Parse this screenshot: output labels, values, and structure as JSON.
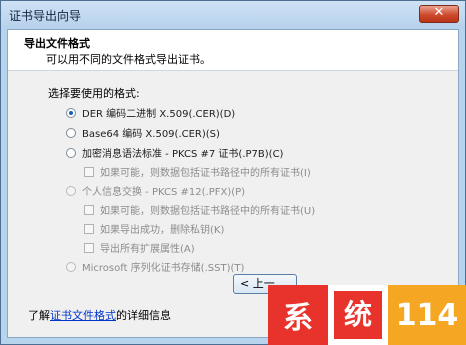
{
  "window": {
    "title": "证书导出向导",
    "close_glyph": "✕"
  },
  "header": {
    "title": "导出文件格式",
    "subtitle": "可以用不同的文件格式导出证书。"
  },
  "body": {
    "prompt": "选择要使用的格式:",
    "options": [
      {
        "label": "DER 编码二进制 X.509(.CER)(D)",
        "type": "radio",
        "checked": true,
        "disabled": false
      },
      {
        "label": "Base64 编码 X.509(.CER)(S)",
        "type": "radio",
        "checked": false,
        "disabled": false
      },
      {
        "label": "加密消息语法标准 - PKCS #7 证书(.P7B)(C)",
        "type": "radio",
        "checked": false,
        "disabled": false
      },
      {
        "label": "如果可能，则数据包括证书路径中的所有证书(I)",
        "type": "checkbox",
        "checked": false,
        "disabled": true
      },
      {
        "label": "个人信息交换 - PKCS #12(.PFX)(P)",
        "type": "radio",
        "checked": false,
        "disabled": true
      },
      {
        "label": "如果可能，则数据包括证书路径中的所有证书(U)",
        "type": "checkbox",
        "checked": false,
        "disabled": true
      },
      {
        "label": "如果导出成功，删除私钥(K)",
        "type": "checkbox",
        "checked": false,
        "disabled": true
      },
      {
        "label": "导出所有扩展属性(A)",
        "type": "checkbox",
        "checked": false,
        "disabled": true
      },
      {
        "label": "Microsoft 序列化证书存储(.SST)(T)",
        "type": "radio",
        "checked": false,
        "disabled": true
      }
    ],
    "learn_more": {
      "prefix": "了解",
      "link": "证书文件格式",
      "suffix": "的详细信息"
    }
  },
  "footer": {
    "back_label": "< 上一"
  },
  "watermark": {
    "char1": "系",
    "char2": "统",
    "number": "114"
  }
}
